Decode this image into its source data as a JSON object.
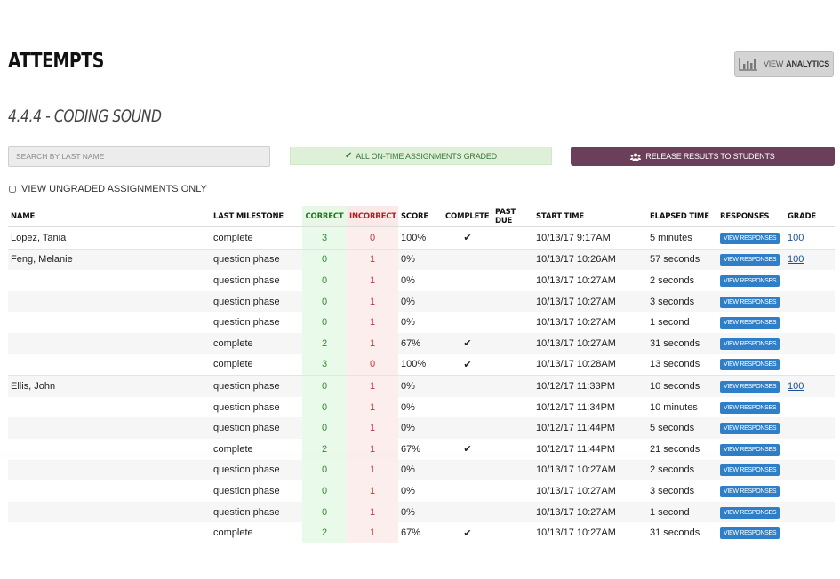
{
  "header": {
    "title": "ATTEMPTS",
    "analytics_prefix": "VIEW",
    "analytics_bold": "ANALYTICS",
    "subtitle": "4.4.4 - CODING SOUND"
  },
  "controls": {
    "search_placeholder": "SEARCH BY LAST NAME",
    "graded_banner": "ALL ON-TIME ASSIGNMENTS GRADED",
    "release_button": "RELEASE RESULTS TO STUDENTS",
    "ungraded_label": "VIEW UNGRADED ASSIGNMENTS ONLY",
    "ungraded_checked": false
  },
  "colors": {
    "release_bg": "#6b3f5a",
    "view_button_bg": "#2f7fc8",
    "correct_text": "#2e8b2e",
    "incorrect_text": "#c23a3a"
  },
  "table": {
    "columns": [
      "NAME",
      "LAST MILESTONE",
      "CORRECT",
      "INCORRECT",
      "SCORE",
      "COMPLETE",
      "PAST DUE",
      "START TIME",
      "ELAPSED TIME",
      "RESPONSES",
      "GRADE"
    ],
    "view_label": "VIEW RESPONSES",
    "rows": [
      {
        "name": "Lopez, Tania",
        "milestone": "complete",
        "correct": "3",
        "incorrect": "0",
        "score": "100%",
        "complete": true,
        "past_due": "",
        "start": "10/13/17 9:17AM",
        "elapsed": "5 minutes",
        "grade": "100",
        "group_start": true
      },
      {
        "name": "Feng, Melanie",
        "milestone": "question phase",
        "correct": "0",
        "incorrect": "1",
        "score": "0%",
        "complete": false,
        "past_due": "",
        "start": "10/13/17 10:26AM",
        "elapsed": "57 seconds",
        "grade": "100",
        "group_start": true
      },
      {
        "name": "",
        "milestone": "question phase",
        "correct": "0",
        "incorrect": "1",
        "score": "0%",
        "complete": false,
        "past_due": "",
        "start": "10/13/17 10:27AM",
        "elapsed": "2 seconds",
        "grade": ""
      },
      {
        "name": "",
        "milestone": "question phase",
        "correct": "0",
        "incorrect": "1",
        "score": "0%",
        "complete": false,
        "past_due": "",
        "start": "10/13/17 10:27AM",
        "elapsed": "3 seconds",
        "grade": ""
      },
      {
        "name": "",
        "milestone": "question phase",
        "correct": "0",
        "incorrect": "1",
        "score": "0%",
        "complete": false,
        "past_due": "",
        "start": "10/13/17 10:27AM",
        "elapsed": "1 second",
        "grade": ""
      },
      {
        "name": "",
        "milestone": "complete",
        "correct": "2",
        "incorrect": "1",
        "score": "67%",
        "complete": true,
        "past_due": "",
        "start": "10/13/17 10:27AM",
        "elapsed": "31 seconds",
        "grade": ""
      },
      {
        "name": "",
        "milestone": "complete",
        "correct": "3",
        "incorrect": "0",
        "score": "100%",
        "complete": true,
        "past_due": "",
        "start": "10/13/17 10:28AM",
        "elapsed": "13 seconds",
        "grade": ""
      },
      {
        "name": "Ellis, John",
        "milestone": "question phase",
        "correct": "0",
        "incorrect": "1",
        "score": "0%",
        "complete": false,
        "past_due": "",
        "start": "10/12/17 11:33PM",
        "elapsed": "10 seconds",
        "grade": "100",
        "group_start": true
      },
      {
        "name": "",
        "milestone": "question phase",
        "correct": "0",
        "incorrect": "1",
        "score": "0%",
        "complete": false,
        "past_due": "",
        "start": "10/12/17 11:34PM",
        "elapsed": "10 minutes",
        "grade": ""
      },
      {
        "name": "",
        "milestone": "question phase",
        "correct": "0",
        "incorrect": "1",
        "score": "0%",
        "complete": false,
        "past_due": "",
        "start": "10/12/17 11:44PM",
        "elapsed": "5 seconds",
        "grade": ""
      },
      {
        "name": "",
        "milestone": "complete",
        "correct": "2",
        "incorrect": "1",
        "score": "67%",
        "complete": true,
        "past_due": "",
        "start": "10/12/17 11:44PM",
        "elapsed": "21 seconds",
        "grade": ""
      },
      {
        "name": "",
        "milestone": "question phase",
        "correct": "0",
        "incorrect": "1",
        "score": "0%",
        "complete": false,
        "past_due": "",
        "start": "10/13/17 10:27AM",
        "elapsed": "2 seconds",
        "grade": ""
      },
      {
        "name": "",
        "milestone": "question phase",
        "correct": "0",
        "incorrect": "1",
        "score": "0%",
        "complete": false,
        "past_due": "",
        "start": "10/13/17 10:27AM",
        "elapsed": "3 seconds",
        "grade": ""
      },
      {
        "name": "",
        "milestone": "question phase",
        "correct": "0",
        "incorrect": "1",
        "score": "0%",
        "complete": false,
        "past_due": "",
        "start": "10/13/17 10:27AM",
        "elapsed": "1 second",
        "grade": ""
      },
      {
        "name": "",
        "milestone": "complete",
        "correct": "2",
        "incorrect": "1",
        "score": "67%",
        "complete": true,
        "past_due": "",
        "start": "10/13/17 10:27AM",
        "elapsed": "31 seconds",
        "grade": ""
      }
    ]
  }
}
